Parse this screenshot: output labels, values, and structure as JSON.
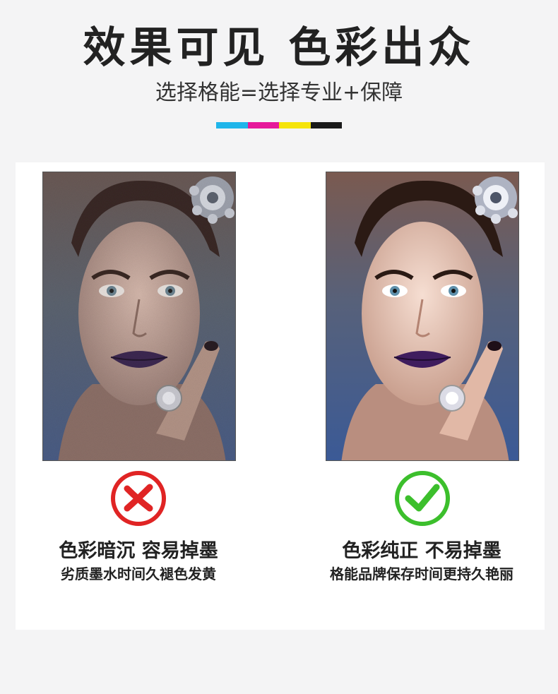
{
  "header": {
    "title": "效果可见 色彩出众",
    "subtitle": "选择格能=选择专业+保障",
    "cmyk_colors": [
      "#1fb5ea",
      "#e6189a",
      "#f5e40a",
      "#1a1a1a"
    ]
  },
  "comparison": {
    "bad": {
      "headline": "色彩暗沉 容易掉墨",
      "detail": "劣质墨水时间久褪色发黄",
      "icon": "cross-circle-icon",
      "color": "#e02424"
    },
    "good": {
      "headline": "色彩纯正 不易掉墨",
      "detail": "格能品牌保存时间更持久艳丽",
      "icon": "check-circle-icon",
      "color": "#3cbf2c"
    }
  }
}
